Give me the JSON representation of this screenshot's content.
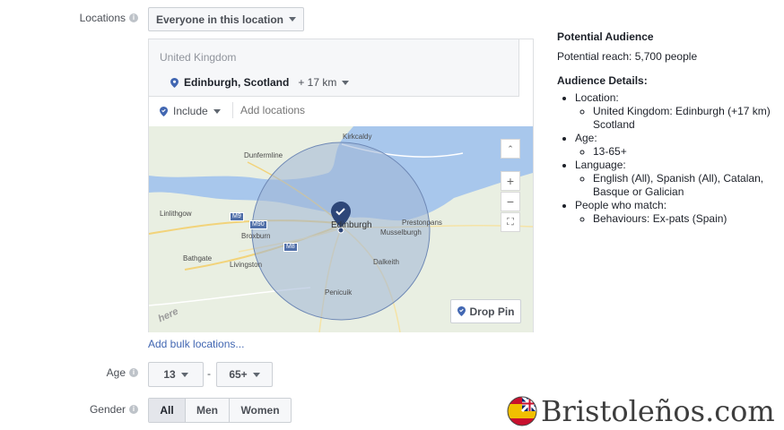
{
  "locations": {
    "label": "Locations",
    "mode_button": "Everyone in this location",
    "country": "United Kingdom",
    "selected_location": "Edinburgh, Scotland",
    "radius": "+ 17 km",
    "include_label": "Include",
    "add_placeholder": "Add locations",
    "bulk_link": "Add bulk locations..."
  },
  "map": {
    "places": [
      "Kirkcaldy",
      "Dunfermline",
      "Linlithgow",
      "Broxburn",
      "Bathgate",
      "Livingston",
      "Edinburgh",
      "Prestonpans",
      "Musselburgh",
      "Dalkeith",
      "Penicuik"
    ],
    "roads": [
      "M9",
      "M90",
      "M8"
    ],
    "drop_pin": "Drop Pin",
    "watermark": "here",
    "zoom_in": "+",
    "zoom_out": "−"
  },
  "age": {
    "label": "Age",
    "min": "13",
    "separator": "-",
    "max": "65+"
  },
  "gender": {
    "label": "Gender",
    "options": [
      "All",
      "Men",
      "Women"
    ],
    "selected": "All"
  },
  "audience": {
    "potential_title": "Potential Audience",
    "potential_reach": "Potential reach: 5,700 people",
    "details_title": "Audience Details:",
    "location_head": "Location:",
    "location_val": "United Kingdom: Edinburgh (+17 km) Scotland",
    "age_head": "Age:",
    "age_val": "13-65+",
    "language_head": "Language:",
    "language_val": "English (All), Spanish (All), Catalan, Basque or Galician",
    "match_head": "People who match:",
    "match_val": "Behaviours: Ex-pats (Spain)"
  },
  "brand": {
    "text": "Bristoleños.com"
  },
  "colors": {
    "accent": "#4267b2",
    "pin": "#3b5998",
    "water": "#a8c7ec",
    "radius_fill": "#9fb4d6"
  }
}
